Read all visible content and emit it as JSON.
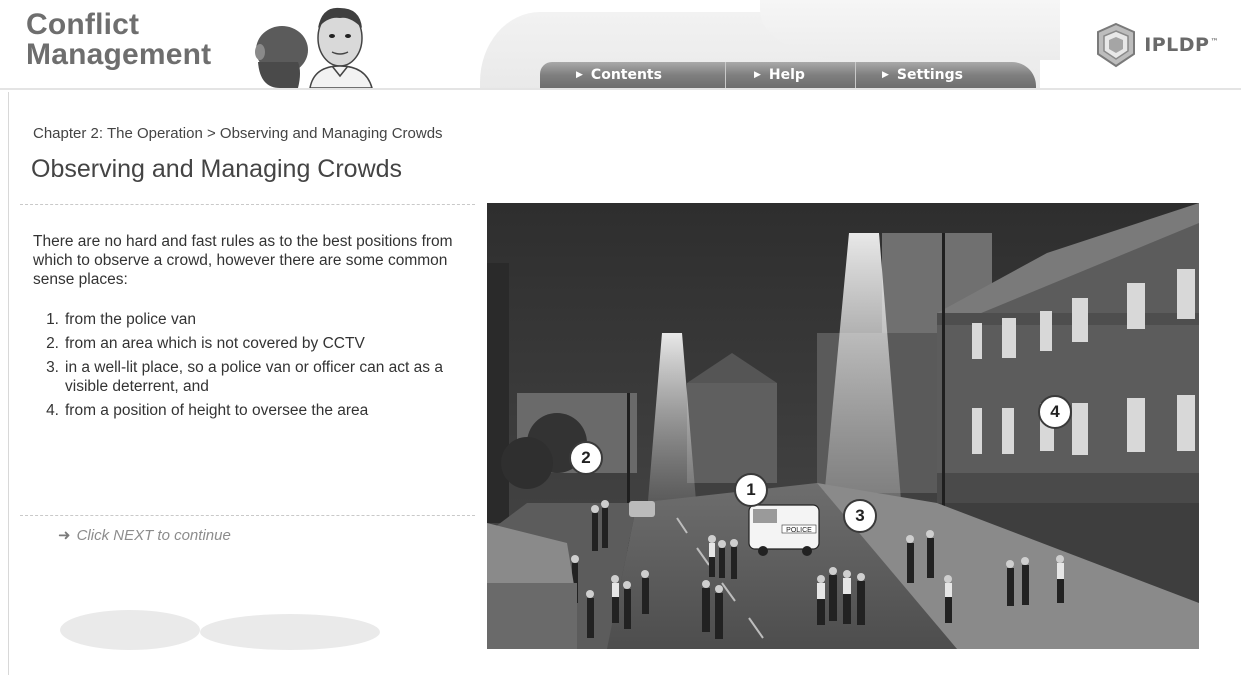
{
  "header": {
    "app_title_line1": "Conflict",
    "app_title_line2": "Management",
    "brand": "IPLDP",
    "brand_tm": "™"
  },
  "nav": {
    "items": [
      {
        "label": "Contents",
        "icon": "caret-right-icon"
      },
      {
        "label": "Help",
        "icon": "caret-right-icon"
      },
      {
        "label": "Settings",
        "icon": "caret-right-icon"
      }
    ]
  },
  "breadcrumb": "Chapter 2: The Operation > Observing and Managing Crowds",
  "page_title": "Observing and Managing Crowds",
  "intro": "There are no hard and fast rules as to the best positions from which to observe a crowd, however there are some common sense places:",
  "points": [
    {
      "num": "1.",
      "text": "from the police van"
    },
    {
      "num": "2.",
      "text": "from an area which is not covered by CCTV"
    },
    {
      "num": "3.",
      "text": "in a well-lit place, so a police van or officer can act as a visible deterrent, and"
    },
    {
      "num": "4.",
      "text": "from a position of height to oversee the area"
    }
  ],
  "next_hint": "Click NEXT to continue",
  "scene": {
    "van_label": "POLICE",
    "markers": [
      "1",
      "2",
      "3",
      "4"
    ]
  },
  "colors": {
    "nav_bar": "#7f7f7f",
    "title_gray": "#6e6e6e",
    "hint_gray": "#8c8c8c"
  }
}
